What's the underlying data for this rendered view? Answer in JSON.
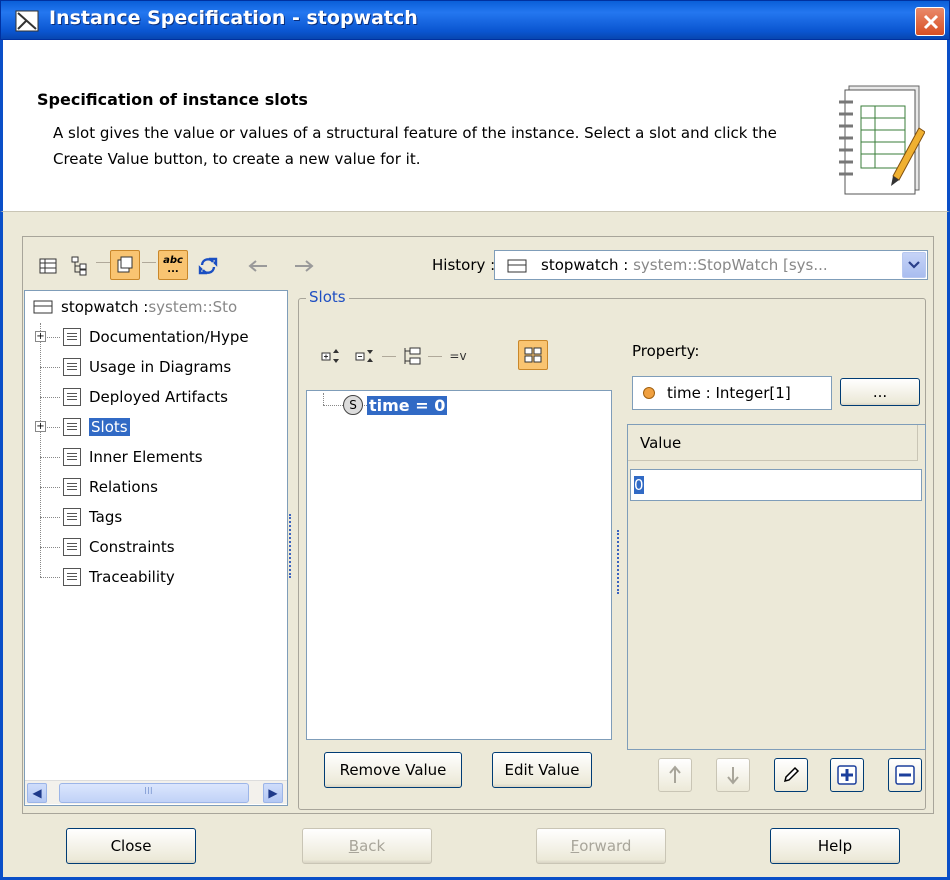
{
  "window": {
    "title": "Instance Specification - stopwatch"
  },
  "banner": {
    "heading": "Specification of instance slots",
    "description": "A slot gives the value or values of a structural feature of the instance. Select a slot and click the Create Value button, to create a new value for it."
  },
  "history": {
    "label": "History :",
    "value_name": "stopwatch : ",
    "value_type": "system::StopWatch",
    "value_suffix": " [sys..."
  },
  "tree": {
    "root_name": "stopwatch : ",
    "root_type": "system::Sto",
    "items": [
      {
        "label": "Documentation/Hype",
        "expandable": true
      },
      {
        "label": "Usage in Diagrams",
        "expandable": false
      },
      {
        "label": "Deployed Artifacts",
        "expandable": false
      },
      {
        "label": "Slots",
        "expandable": true,
        "selected": true
      },
      {
        "label": "Inner Elements",
        "expandable": false
      },
      {
        "label": "Relations",
        "expandable": false
      },
      {
        "label": "Tags",
        "expandable": false
      },
      {
        "label": "Constraints",
        "expandable": false
      },
      {
        "label": "Traceability",
        "expandable": false
      }
    ],
    "scroll_thumb_glyph": "III"
  },
  "slots": {
    "legend": "Slots",
    "slot_item": "time = 0",
    "slot_icon_glyph": "S",
    "remove_value": "Remove Value",
    "edit_value": "Edit Value",
    "tool_text": "=v"
  },
  "property": {
    "label": "Property:",
    "value": "time : Integer[1]",
    "browse_label": "..."
  },
  "values": {
    "header": "Value",
    "cell": "0"
  },
  "footer": {
    "close": "Close",
    "back_first": "B",
    "back_rest": "ack",
    "forward_first": "F",
    "forward_rest": "orward",
    "help": "Help"
  },
  "toolbar": {
    "abc_text": "abc",
    "abc_dots": "..."
  },
  "colors": {
    "selection": "#316ac5",
    "title_bar": "#0a5fd8",
    "active_tool": "#f9c471"
  }
}
